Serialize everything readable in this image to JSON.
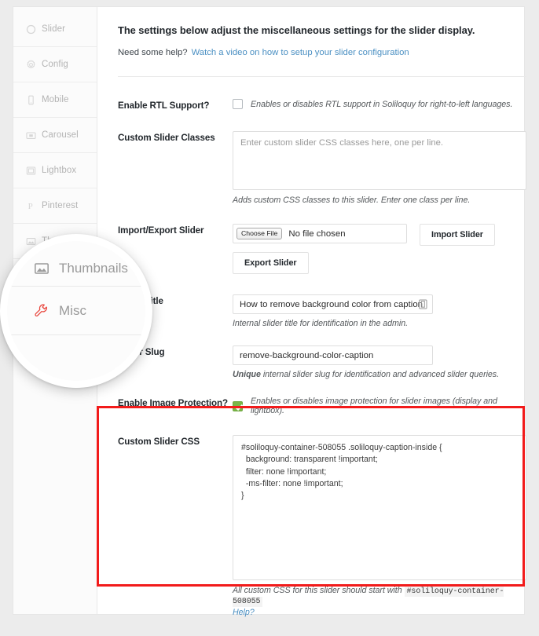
{
  "sidebar": {
    "items": [
      {
        "label": "Slider",
        "icon": "circle-icon"
      },
      {
        "label": "Config",
        "icon": "gear-icon"
      },
      {
        "label": "Mobile",
        "icon": "mobile-icon"
      },
      {
        "label": "Carousel",
        "icon": "carousel-icon"
      },
      {
        "label": "Lightbox",
        "icon": "lightbox-icon"
      },
      {
        "label": "Pinterest",
        "icon": "pinterest-icon"
      },
      {
        "label": "Thumbnails",
        "icon": "thumbnails-icon"
      }
    ]
  },
  "magnifier": {
    "items": [
      {
        "label": "Thumbnails",
        "icon": "thumbnails-icon",
        "color": "#9a9a9a"
      },
      {
        "label": "Misc",
        "icon": "wrench-icon",
        "color": "#e8453c"
      }
    ]
  },
  "main": {
    "intro_title": "The settings below adjust the miscellaneous settings for the slider display.",
    "help_prefix": "Need some help?",
    "help_link": "Watch a video on how to setup your slider configuration",
    "rows": {
      "rtl": {
        "label": "Enable RTL Support?",
        "checked": false,
        "description": "Enables or disables RTL support in Soliloquy for right-to-left languages."
      },
      "classes": {
        "label": "Custom Slider Classes",
        "value": "",
        "placeholder": "Enter custom slider CSS classes here, one per line.",
        "description": "Adds custom CSS classes to this slider. Enter one class per line."
      },
      "import_export": {
        "label": "Import/Export Slider",
        "choose_file_label": "Choose File",
        "no_file_text": "No file chosen",
        "import_button": "Import Slider",
        "export_button": "Export Slider"
      },
      "title": {
        "label": "Slider Title",
        "value": "How to remove background color from caption",
        "description": "Internal slider title for identification in the admin.",
        "icon": "clipboard-icon"
      },
      "slug": {
        "label": "Slider Slug",
        "value": "remove-background-color-caption",
        "description_bold": "Unique",
        "description_rest": " internal slider slug for identification and advanced slider queries."
      },
      "image_protection": {
        "label": "Enable Image Protection?",
        "checked": true,
        "description": "Enables or disables image protection for slider images (display and lightbox)."
      },
      "custom_css": {
        "label": "Custom Slider CSS",
        "value": "#soliloquy-container-508055 .soliloquy-caption-inside {\n  background: transparent !important;\n  filter: none !important;\n  -ms-filter: none !important;\n}",
        "description_prefix": "All custom CSS for this slider should start with",
        "container_id": "#soliloquy-container-508055",
        "help_link": "Help?"
      }
    }
  },
  "colors": {
    "accent_link": "#4a8fc2",
    "checkbox_green": "#7ab648",
    "highlight_red": "#f21b1b",
    "misc_icon_red": "#e8453c"
  }
}
